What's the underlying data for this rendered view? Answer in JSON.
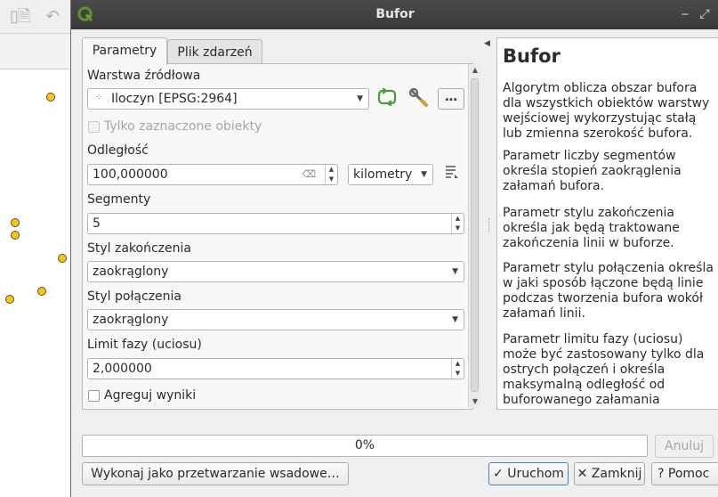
{
  "window": {
    "title": "Bufor"
  },
  "tabs": [
    {
      "label": "Parametry"
    },
    {
      "label": "Plik zdarzeń"
    }
  ],
  "form": {
    "source_layer_label": "Warstwa źródłowa",
    "source_layer_value": "Iloczyn [EPSG:2964]",
    "browse_button": "…",
    "selected_only_label": "Tylko zaznaczone obiekty",
    "selected_only_checked": false,
    "distance_label": "Odległość",
    "distance_value": "100,000000",
    "distance_unit": "kilometry",
    "segments_label": "Segmenty",
    "segments_value": "5",
    "end_cap_label": "Styl zakończenia",
    "end_cap_value": "zaokrąglony",
    "join_label": "Styl połączenia",
    "join_value": "zaokrąglony",
    "miter_label": "Limit fazy (uciosu)",
    "miter_value": "2,000000",
    "dissolve_label": "Agreguj wyniki",
    "dissolve_checked": false
  },
  "help": {
    "title": "Bufor",
    "paragraphs": [
      "Algorytm oblicza obszar bufora dla wszystkich obiektów warstwy wejściowej wykorzystując stałą lub zmienna szerokość bufora.",
      "Parametr liczby segmentów określa stopień zaokrąglenia załamań bufora.",
      "Parametr stylu zakończenia określa jak będą traktowane zakończenia linii w buforze.",
      "Parametr stylu połączenia określa w jaki sposób łączone będą linie podczas tworzenia bufora wokół załamań linii.",
      "Parametr limitu fazy (uciosu) może być zastosowany tylko dla ostrych połączeń i określa maksymalną odległość od buforowanego załamania podczas"
    ]
  },
  "progress": {
    "value": 0,
    "label": "0%"
  },
  "buttons": {
    "cancel": "Anuluj",
    "batch": "Wykonaj jako przetwarzanie wsadowe…",
    "run": "Uruchom",
    "close": "Zamknij",
    "help": "Pomoc"
  },
  "colors": {
    "titlebar": "#3f3f3f",
    "map_point": "#f2c230",
    "qgis_green": "#589632",
    "qgis_yellow": "#ee7913"
  },
  "icons": {
    "refresh": "refresh-icon",
    "wrench": "wrench-icon",
    "data_defined": "data-defined-icon",
    "clear": "clear-icon"
  }
}
